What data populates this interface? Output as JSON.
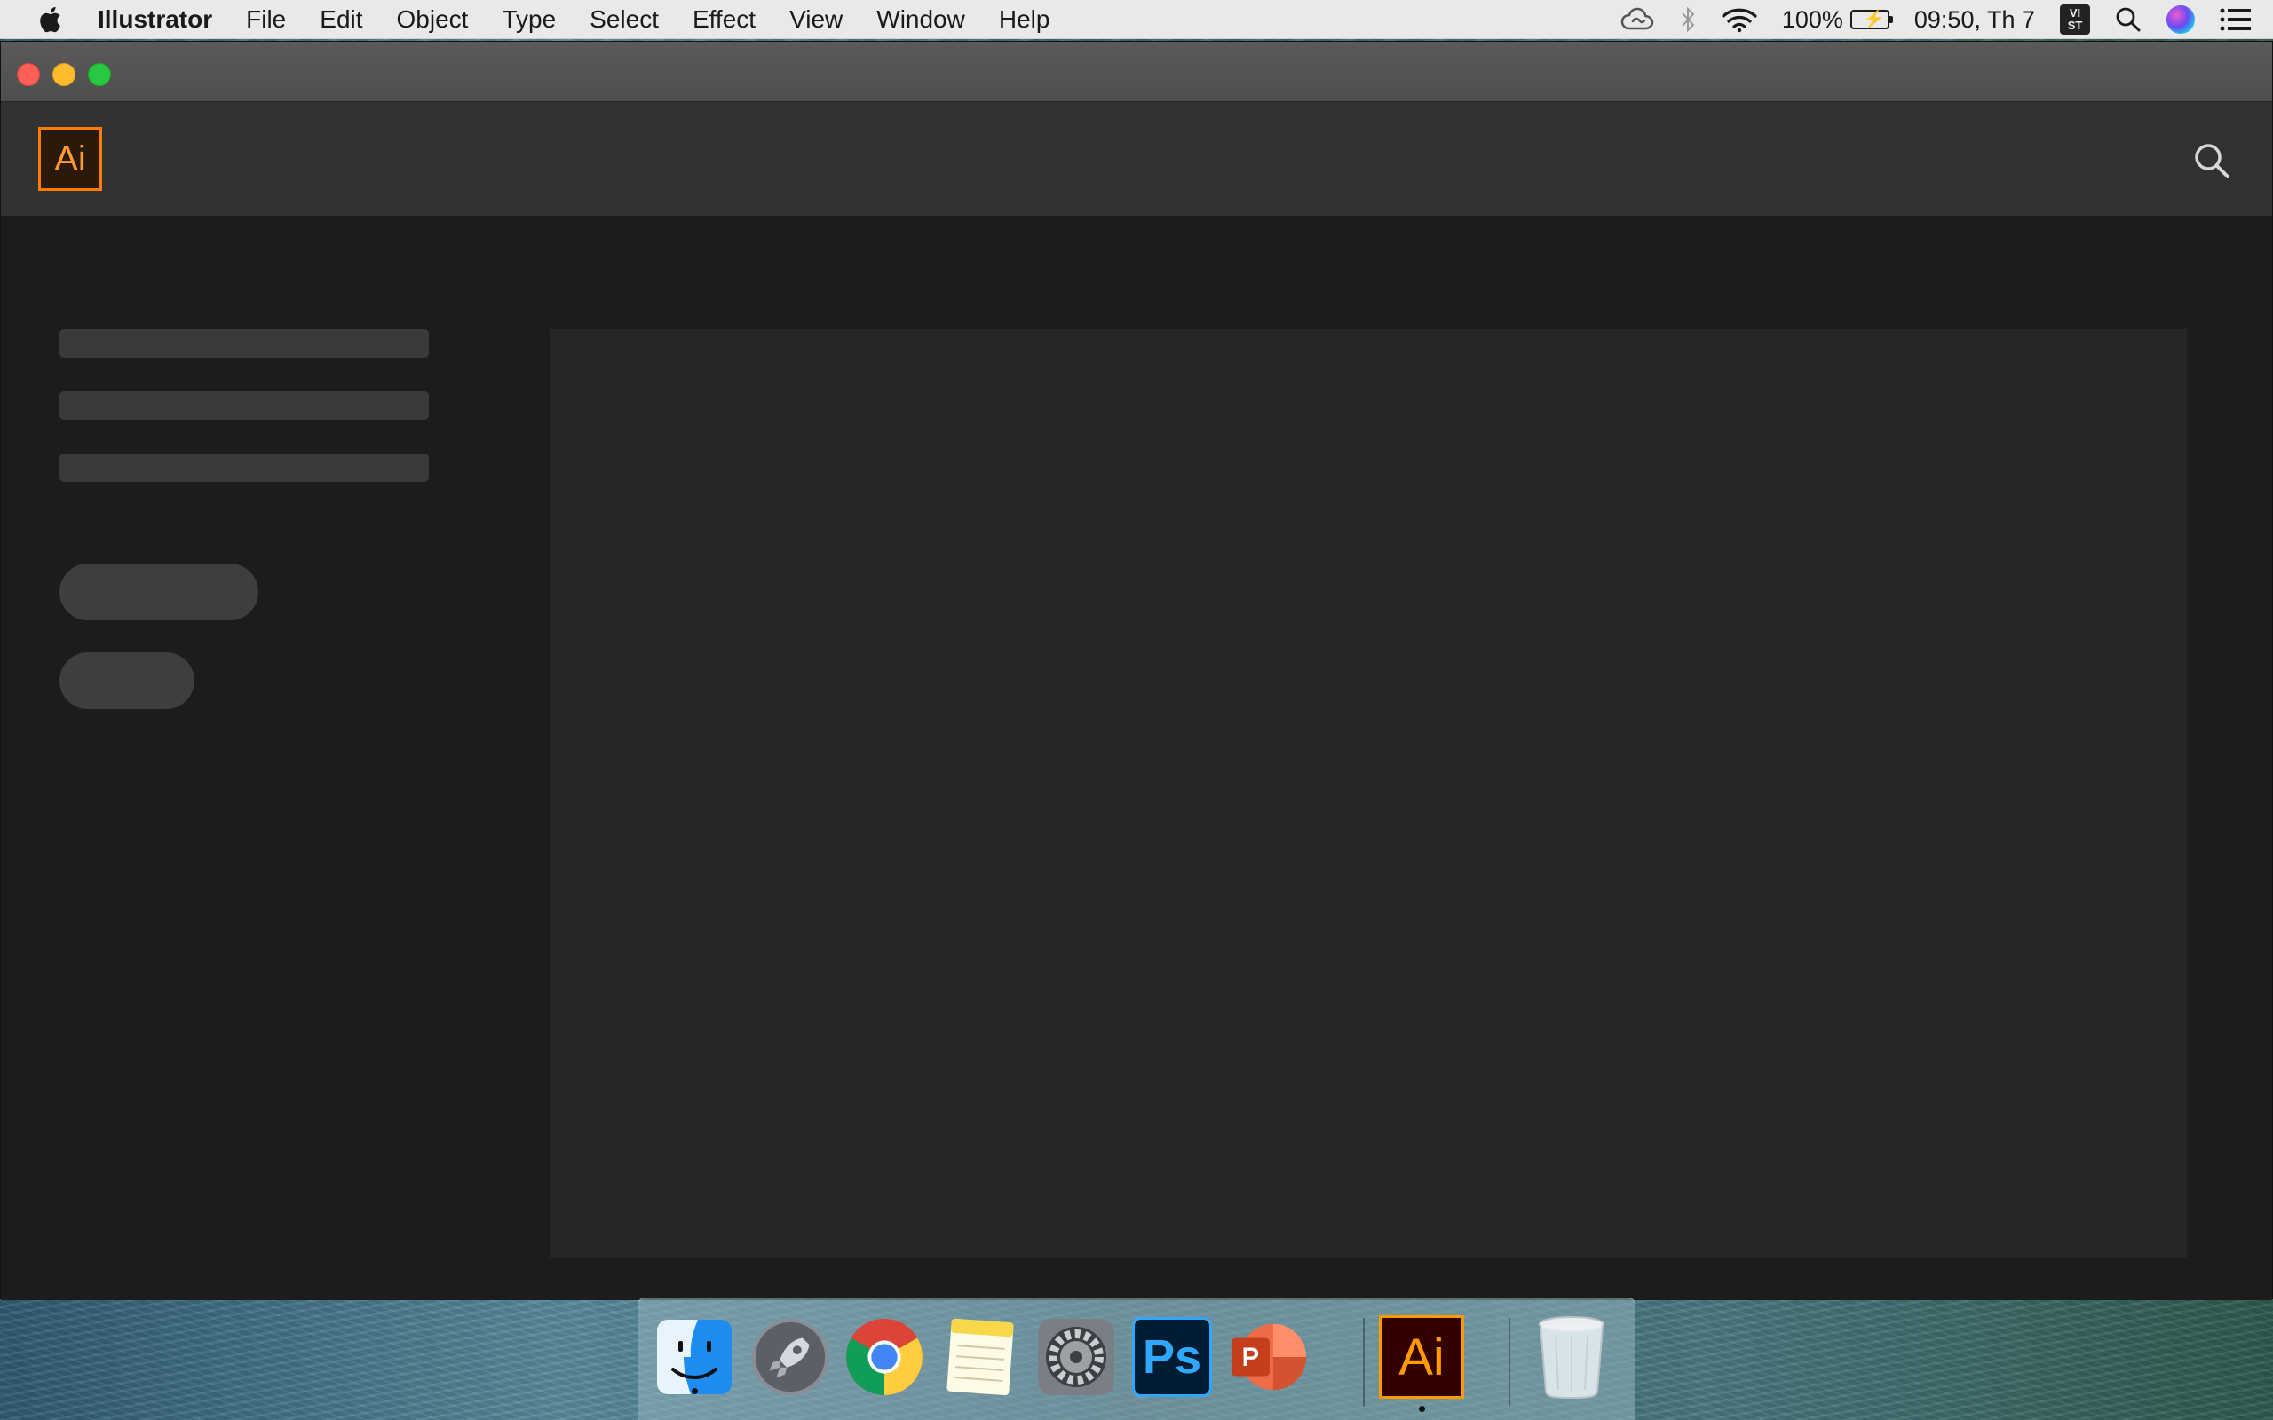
{
  "menubar": {
    "app_name": "Illustrator",
    "menus": [
      "File",
      "Edit",
      "Object",
      "Type",
      "Select",
      "Effect",
      "View",
      "Window",
      "Help"
    ],
    "battery_percent": "100%",
    "clock": "09:50, Th 7",
    "input_source": [
      "VI",
      "ST"
    ]
  },
  "app": {
    "logo_text": "Ai"
  },
  "dock": {
    "photoshop_label": "Ps",
    "powerpoint_label": "P",
    "illustrator_label": "Ai"
  },
  "colors": {
    "illustrator_orange": "#ff9a00",
    "photoshop_blue": "#31a8ff",
    "window_bg": "#1c1c1c",
    "header_bg": "#323232"
  }
}
